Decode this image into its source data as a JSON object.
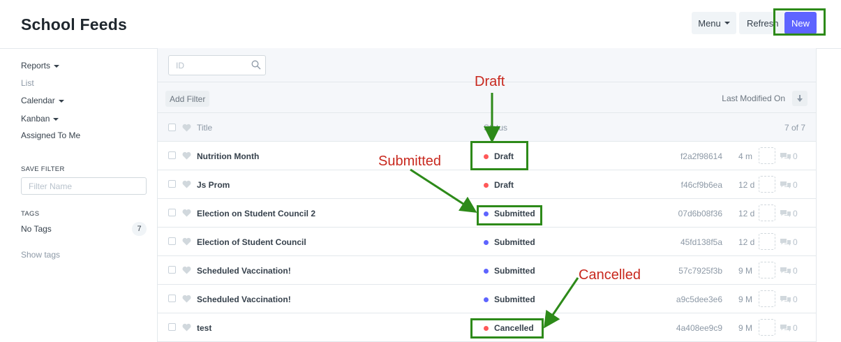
{
  "header": {
    "title": "School Feeds",
    "menu_label": "Menu",
    "refresh_label": "Refresh",
    "new_label": "New"
  },
  "sidebar": {
    "items": [
      {
        "label": "Reports",
        "dropdown": true
      },
      {
        "label": "List",
        "dropdown": false
      },
      {
        "label": "Calendar",
        "dropdown": true
      },
      {
        "label": "Kanban",
        "dropdown": true
      },
      {
        "label": "Assigned To Me",
        "dropdown": false
      }
    ],
    "save_filter_label": "SAVE FILTER",
    "filter_name_placeholder": "Filter Name",
    "tags_label": "TAGS",
    "no_tags_label": "No Tags",
    "no_tags_count": "7",
    "show_tags_label": "Show tags"
  },
  "list": {
    "search_placeholder": "ID",
    "add_filter_label": "Add Filter",
    "sort_label": "Last Modified On",
    "columns": {
      "title": "Title",
      "status": "Status",
      "count": "7 of 7"
    },
    "rows": [
      {
        "title": "Nutrition Month",
        "status": "Draft",
        "status_color": "#ff5858",
        "name": "f2a2f98614",
        "modified": "4 m",
        "comments": "0"
      },
      {
        "title": "Js Prom",
        "status": "Draft",
        "status_color": "#ff5858",
        "name": "f46cf9b6ea",
        "modified": "12 d",
        "comments": "0"
      },
      {
        "title": "Election on Student Council 2",
        "status": "Submitted",
        "status_color": "#5e64ff",
        "name": "07d6b08f36",
        "modified": "12 d",
        "comments": "0"
      },
      {
        "title": "Election of Student Council",
        "status": "Submitted",
        "status_color": "#5e64ff",
        "name": "45fd138f5a",
        "modified": "12 d",
        "comments": "0"
      },
      {
        "title": "Scheduled Vaccination!",
        "status": "Submitted",
        "status_color": "#5e64ff",
        "name": "57c7925f3b",
        "modified": "9 M",
        "comments": "0"
      },
      {
        "title": "Scheduled Vaccination!",
        "status": "Submitted",
        "status_color": "#5e64ff",
        "name": "a9c5dee3e6",
        "modified": "9 M",
        "comments": "0"
      },
      {
        "title": "test",
        "status": "Cancelled",
        "status_color": "#ff5858",
        "name": "4a408ee9c9",
        "modified": "9 M",
        "comments": "0"
      }
    ]
  },
  "annotations": {
    "draft": "Draft",
    "submitted": "Submitted",
    "cancelled": "Cancelled",
    "color_box": "#2d8a19",
    "color_text": "#c8281e"
  },
  "colors": {
    "primary": "#5e64ff",
    "draft": "#ff5858",
    "submitted": "#5e64ff"
  }
}
